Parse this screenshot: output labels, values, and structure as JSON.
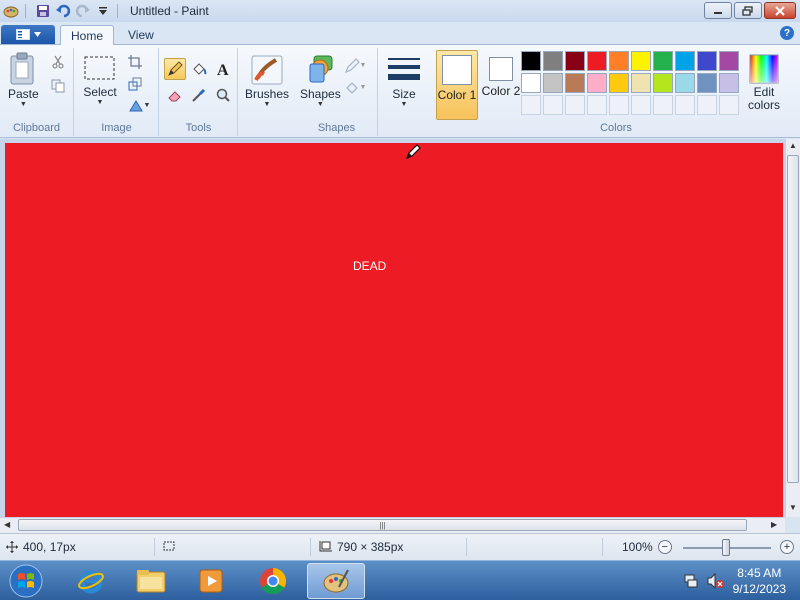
{
  "window": {
    "title": "Untitled - Paint",
    "quick_access": [
      "save-icon",
      "undo-icon",
      "redo-icon",
      "customize-dropdown-icon"
    ]
  },
  "tabs": [
    {
      "label": "Home",
      "active": true
    },
    {
      "label": "View",
      "active": false
    }
  ],
  "ribbon": {
    "clipboard": {
      "group_label": "Clipboard",
      "paste_label": "Paste"
    },
    "image": {
      "group_label": "Image",
      "select_label": "Select"
    },
    "tools": {
      "group_label": "Tools",
      "selected_tool": "pencil"
    },
    "brushes": {
      "label": "Brushes"
    },
    "shapes": {
      "group_label": "Shapes",
      "shapes_label": "Shapes"
    },
    "size": {
      "label": "Size"
    },
    "colors": {
      "group_label": "Colors",
      "color1_label": "Color 1",
      "color2_label": "Color 2",
      "color1_value": "#ffffff",
      "color2_value": "#ffffff",
      "edit_colors_label": "Edit colors",
      "palette_row1": [
        "#000000",
        "#7f7f7f",
        "#880015",
        "#ed1c24",
        "#ff7f27",
        "#fff200",
        "#22b14c",
        "#00a2e8",
        "#3f48cc",
        "#a349a4"
      ],
      "palette_row2": [
        "#ffffff",
        "#c3c3c3",
        "#b97a57",
        "#ffaec9",
        "#ffc90e",
        "#efe4b0",
        "#b5e61d",
        "#99d9ea",
        "#7092be",
        "#c8bfe7"
      ]
    }
  },
  "canvas": {
    "background_color": "#ed1c24",
    "text": "DEAD",
    "text_color": "#ffffff"
  },
  "statusbar": {
    "cursor_position": "400, 17px",
    "canvas_size": "790 × 385px",
    "zoom": "100%"
  },
  "taskbar": {
    "apps": [
      "internet-explorer-icon",
      "file-explorer-icon",
      "media-player-icon",
      "chrome-icon",
      "paint-icon"
    ],
    "active_app": "paint",
    "time": "8:45 AM",
    "date": "9/12/2023"
  }
}
